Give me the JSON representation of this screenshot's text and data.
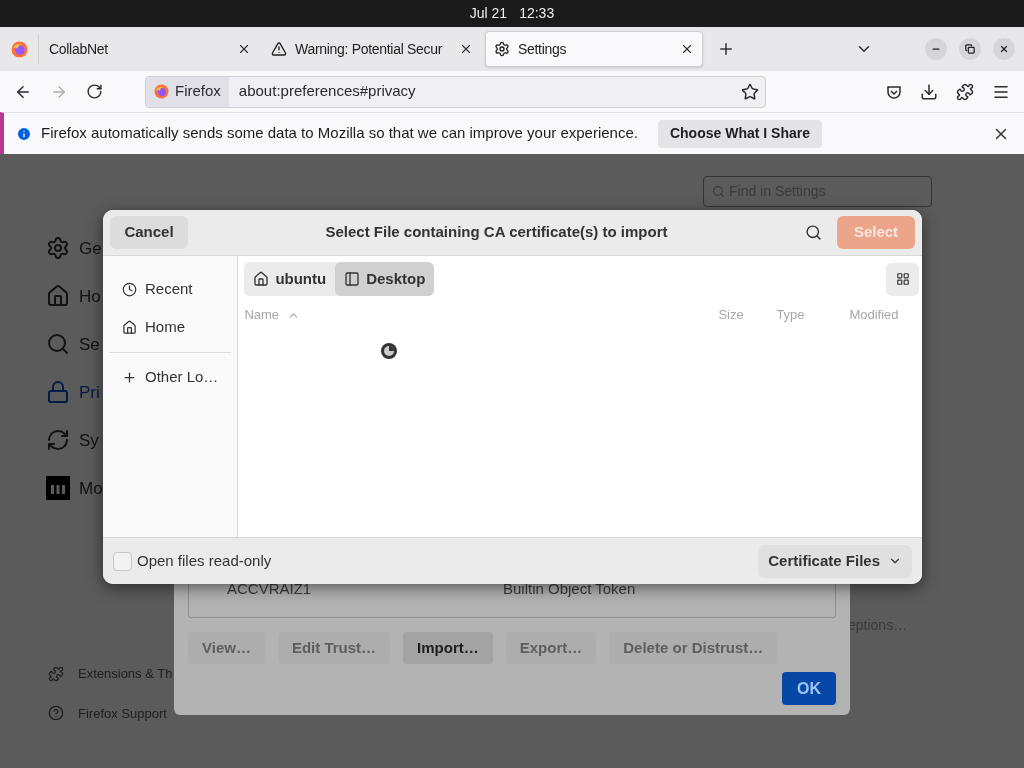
{
  "top_bar": {
    "date": "Jul 21",
    "time": "12:33"
  },
  "tabs": [
    {
      "title": "CollabNet",
      "selected": false
    },
    {
      "title": "Warning: Potential Secur",
      "selected": false
    },
    {
      "title": "Settings",
      "selected": true
    }
  ],
  "address_bar": {
    "identity": "Firefox",
    "url": "about:preferences#privacy"
  },
  "notification": {
    "message": "Firefox automatically sends some data to Mozilla so that we can improve your experience.",
    "button": "Choose What I Share"
  },
  "settings": {
    "search_placeholder": "Find in Settings",
    "nav": [
      {
        "label": "Ge",
        "selected": false
      },
      {
        "label": "Ho",
        "selected": false
      },
      {
        "label": "Se",
        "selected": false
      },
      {
        "label": "Pri",
        "selected": true
      },
      {
        "label": "Sy",
        "selected": false
      },
      {
        "label": "Mo",
        "selected": false
      }
    ],
    "footer_links": [
      "Extensions & Th",
      "Firefox Support"
    ],
    "partial_text": "eptions…"
  },
  "certificate_manager": {
    "rows": [
      {
        "name": "ACCVRAIZ1",
        "token": "Builtin Object Token"
      }
    ],
    "buttons": [
      {
        "label": "View…",
        "disabled": true
      },
      {
        "label": "Edit Trust…",
        "disabled": true
      },
      {
        "label": "Import…",
        "disabled": false
      },
      {
        "label": "Export…",
        "disabled": true
      },
      {
        "label": "Delete or Distrust…",
        "disabled": true
      }
    ],
    "ok": "OK"
  },
  "file_dialog": {
    "title": "Select File containing CA certificate(s) to import",
    "cancel": "Cancel",
    "select": {
      "label": "Select",
      "disabled": true
    },
    "places": [
      {
        "label": "Recent"
      },
      {
        "label": "Home"
      }
    ],
    "other_locations": "Other Lo…",
    "path": [
      {
        "label": "ubuntu",
        "selected": false
      },
      {
        "label": "Desktop",
        "selected": true
      }
    ],
    "columns": [
      "Name",
      "Size",
      "Type",
      "Modified"
    ],
    "loading": true,
    "read_only": {
      "label": "Open files read-only",
      "checked": false
    },
    "filter": "Certificate Files"
  }
}
